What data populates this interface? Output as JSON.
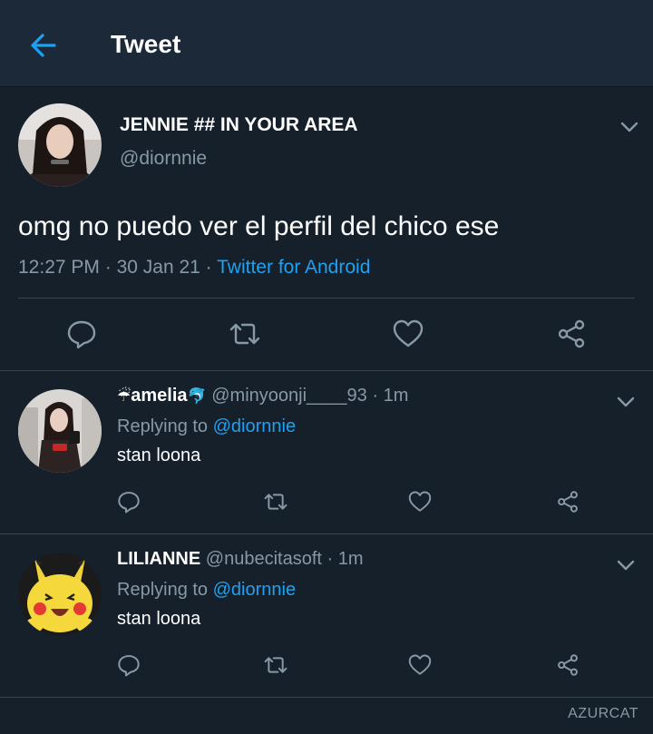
{
  "header": {
    "title": "Tweet",
    "back_icon": "arrow-left-icon",
    "accent": "#1da1f2"
  },
  "main_tweet": {
    "display_name": "JENNIE ## IN YOUR AREA",
    "handle": "@diornnie",
    "text": "omg no puedo ver el perfil del chico ese",
    "time": "12:27 PM",
    "date": "30 Jan 21",
    "source": "Twitter for Android",
    "actions": [
      "reply-icon",
      "retweet-icon",
      "like-icon",
      "share-icon"
    ]
  },
  "replies": [
    {
      "name_prefix_emoji": "☔",
      "display_name": "amelia",
      "name_suffix_emoji": "🐬",
      "handle": "@minyoonji____93",
      "time_ago": "1m",
      "replying_label": "Replying to",
      "replying_to": "@diornnie",
      "text": "stan loona"
    },
    {
      "display_name": "LILIANNE",
      "handle": "@nubecitasoft",
      "time_ago": "1m",
      "replying_label": "Replying to",
      "replying_to": "@diornnie",
      "text": "stan loona"
    }
  ],
  "separator": "·",
  "watermark": "AZURCAT",
  "colors": {
    "background": "#15202b",
    "header": "#1c2938",
    "muted": "#8899a6",
    "accent": "#1da1f2"
  }
}
